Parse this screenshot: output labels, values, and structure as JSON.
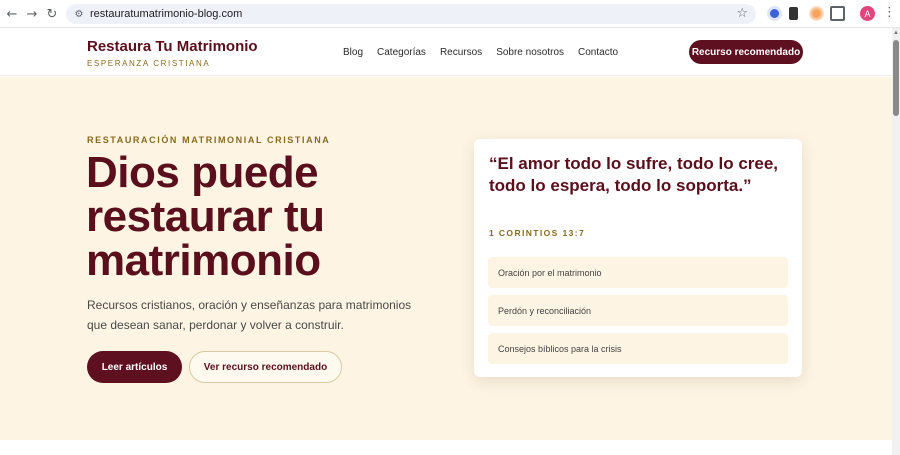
{
  "browser": {
    "url": "restauratumatrimonio-blog.com",
    "back_icon": "←",
    "forward_icon": "→",
    "reload_icon": "↻",
    "profile_initial": "A"
  },
  "site": {
    "brand_name": "Restaura Tu Matrimonio",
    "brand_tagline": "ESPERANZA CRISTIANA",
    "nav": [
      "Blog",
      "Categorías",
      "Recursos",
      "Sobre nosotros",
      "Contacto"
    ],
    "cta": "Recurso recomendado"
  },
  "hero": {
    "eyebrow": "RESTAURACIÓN MATRIMONIAL CRISTIANA",
    "headline": "Dios puede restaurar tu matrimonio",
    "lead": "Recursos cristianos, oración y enseñanzas para matrimonios que desean sanar, perdonar y volver a construir.",
    "primary_button": "Leer artículos",
    "secondary_button": "Ver recurso recomendado"
  },
  "card": {
    "quote": "“El amor todo lo sufre, todo lo cree, todo lo espera, todo lo soporta.”",
    "reference": "1 CORINTIOS 13:7",
    "topics": [
      "Oración por el matrimonio",
      "Perdón y reconciliación",
      "Consejos bíblicos para la crisis"
    ]
  },
  "colors": {
    "brand": "#5e1020",
    "accent_gold": "#8a6a1e",
    "hero_bg": "#fdf4e3"
  }
}
